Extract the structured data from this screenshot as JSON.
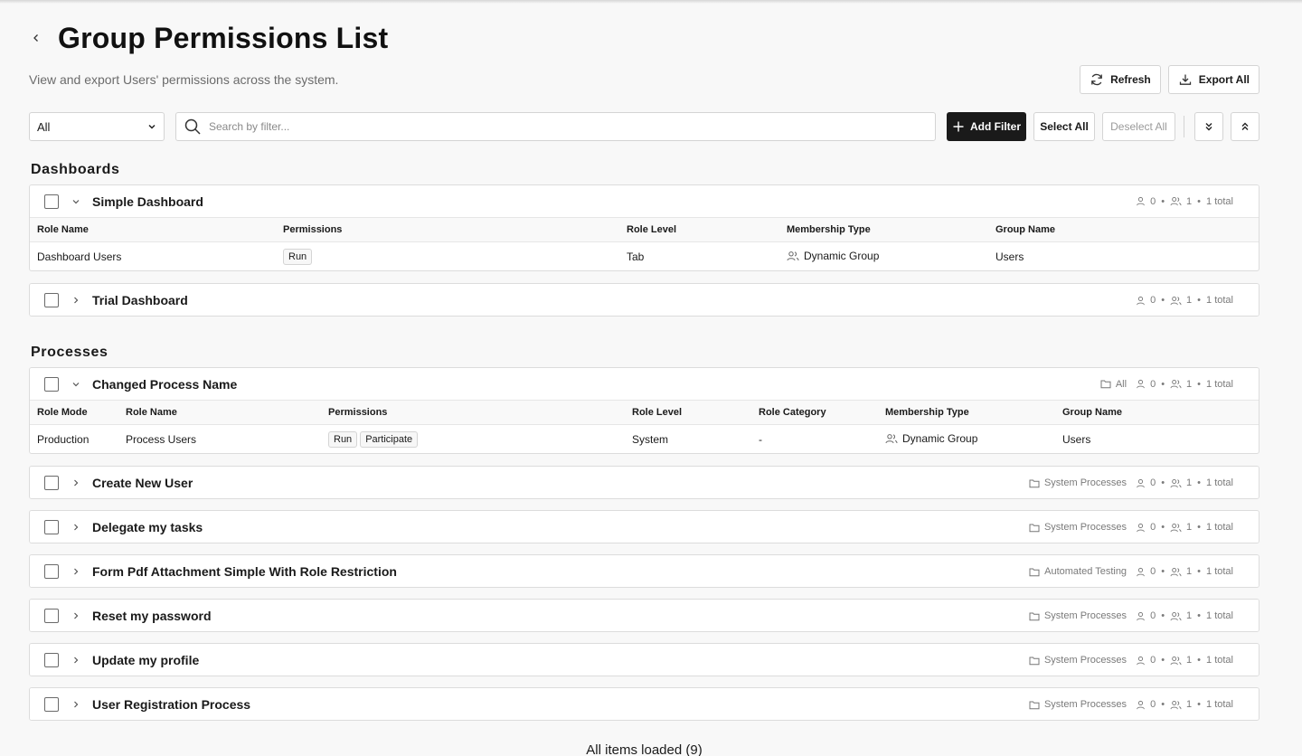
{
  "header": {
    "title": "Group Permissions List",
    "subtitle": "View and export Users' permissions across the system.",
    "refresh_label": "Refresh",
    "export_label": "Export All"
  },
  "toolbar": {
    "filter_value": "All",
    "search_placeholder": "Search by filter...",
    "add_filter_label": "Add Filter",
    "select_all_label": "Select All",
    "deselect_all_label": "Deselect All"
  },
  "dashboards": {
    "title": "Dashboards",
    "columns": [
      "Role Name",
      "Permissions",
      "Role Level",
      "Membership Type",
      "Group Name"
    ],
    "groups": [
      {
        "name": "Simple Dashboard",
        "expanded": true,
        "users": "0",
        "groups": "1",
        "total": "1 total",
        "rows": [
          {
            "role_name": "Dashboard Users",
            "permissions": [
              "Run"
            ],
            "role_level": "Tab",
            "membership": "Dynamic Group",
            "group_name": "Users"
          }
        ]
      },
      {
        "name": "Trial Dashboard",
        "expanded": false,
        "users": "0",
        "groups": "1",
        "total": "1 total"
      }
    ]
  },
  "processes": {
    "title": "Processes",
    "columns": [
      "Role Mode",
      "Role Name",
      "Permissions",
      "Role Level",
      "Role Category",
      "Membership Type",
      "Group Name"
    ],
    "groups": [
      {
        "name": "Changed Process Name",
        "expanded": true,
        "folder": "All",
        "users": "0",
        "groups": "1",
        "total": "1 total",
        "rows": [
          {
            "role_mode": "Production",
            "role_name": "Process Users",
            "permissions": [
              "Run",
              "Participate"
            ],
            "role_level": "System",
            "role_category": "-",
            "membership": "Dynamic Group",
            "group_name": "Users"
          }
        ]
      },
      {
        "name": "Create New User",
        "expanded": false,
        "folder": "System Processes",
        "users": "0",
        "groups": "1",
        "total": "1 total"
      },
      {
        "name": "Delegate my tasks",
        "expanded": false,
        "folder": "System Processes",
        "users": "0",
        "groups": "1",
        "total": "1 total"
      },
      {
        "name": "Form Pdf Attachment Simple With Role Restriction",
        "expanded": false,
        "folder": "Automated Testing",
        "users": "0",
        "groups": "1",
        "total": "1 total"
      },
      {
        "name": "Reset my password",
        "expanded": false,
        "folder": "System Processes",
        "users": "0",
        "groups": "1",
        "total": "1 total"
      },
      {
        "name": "Update my profile",
        "expanded": false,
        "folder": "System Processes",
        "users": "0",
        "groups": "1",
        "total": "1 total"
      },
      {
        "name": "User Registration Process",
        "expanded": false,
        "folder": "System Processes",
        "users": "0",
        "groups": "1",
        "total": "1 total"
      }
    ]
  },
  "footer": {
    "status": "All items loaded (9)"
  }
}
